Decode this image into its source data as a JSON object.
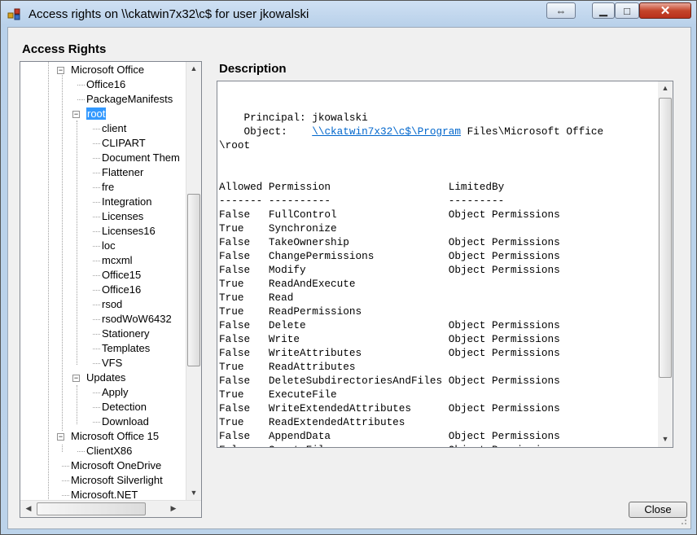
{
  "window": {
    "title": "Access rights on \\\\ckatwin7x32\\c$ for user jkowalski",
    "restore_glyph": "⇔",
    "min_glyph": "▁",
    "max_glyph": "□",
    "close_glyph": "✕"
  },
  "left_panel": {
    "heading": "Access Rights",
    "tree": [
      {
        "label": "Microsoft Office",
        "expander": "−"
      },
      {
        "label": "Office16"
      },
      {
        "label": "PackageManifests"
      },
      {
        "label": "root",
        "expander": "−",
        "selected": true
      },
      {
        "label": "client"
      },
      {
        "label": "CLIPART"
      },
      {
        "label": "Document Them"
      },
      {
        "label": "Flattener"
      },
      {
        "label": "fre"
      },
      {
        "label": "Integration"
      },
      {
        "label": "Licenses"
      },
      {
        "label": "Licenses16"
      },
      {
        "label": "loc"
      },
      {
        "label": "mcxml"
      },
      {
        "label": "Office15"
      },
      {
        "label": "Office16"
      },
      {
        "label": "rsod"
      },
      {
        "label": "rsodWoW6432"
      },
      {
        "label": "Stationery"
      },
      {
        "label": "Templates"
      },
      {
        "label": "VFS"
      },
      {
        "label": "Updates",
        "expander": "−"
      },
      {
        "label": "Apply"
      },
      {
        "label": "Detection"
      },
      {
        "label": "Download"
      },
      {
        "label": "Microsoft Office 15",
        "expander": "−"
      },
      {
        "label": "ClientX86"
      },
      {
        "label": "Microsoft OneDrive"
      },
      {
        "label": "Microsoft Silverlight"
      },
      {
        "label": "Microsoft.NET"
      }
    ]
  },
  "description": {
    "heading": "Description",
    "principal_label": "Principal:",
    "principal": "jkowalski",
    "object_label": "Object:",
    "object_link": "\\\\ckatwin7x32\\c$\\Program",
    "object_rest": " Files\\Microsoft Office",
    "object_cont": "\\root",
    "columns": [
      "Allowed",
      "Permission",
      "LimitedBy"
    ],
    "separators": [
      "-------",
      "----------",
      "---------"
    ],
    "rows": [
      [
        "False",
        "FullControl",
        "Object Permissions"
      ],
      [
        "True",
        "Synchronize",
        ""
      ],
      [
        "False",
        "TakeOwnership",
        "Object Permissions"
      ],
      [
        "False",
        "ChangePermissions",
        "Object Permissions"
      ],
      [
        "False",
        "Modify",
        "Object Permissions"
      ],
      [
        "True",
        "ReadAndExecute",
        ""
      ],
      [
        "True",
        "Read",
        ""
      ],
      [
        "True",
        "ReadPermissions",
        ""
      ],
      [
        "False",
        "Delete",
        "Object Permissions"
      ],
      [
        "False",
        "Write",
        "Object Permissions"
      ],
      [
        "False",
        "WriteAttributes",
        "Object Permissions"
      ],
      [
        "True",
        "ReadAttributes",
        ""
      ],
      [
        "False",
        "DeleteSubdirectoriesAndFiles",
        "Object Permissions"
      ],
      [
        "True",
        "ExecuteFile",
        ""
      ],
      [
        "False",
        "WriteExtendedAttributes",
        "Object Permissions"
      ],
      [
        "True",
        "ReadExtendedAttributes",
        ""
      ],
      [
        "False",
        "AppendData",
        "Object Permissions"
      ],
      [
        "False",
        "CreateFiles",
        "Object Permissions"
      ]
    ]
  },
  "buttons": {
    "close": "Close"
  }
}
